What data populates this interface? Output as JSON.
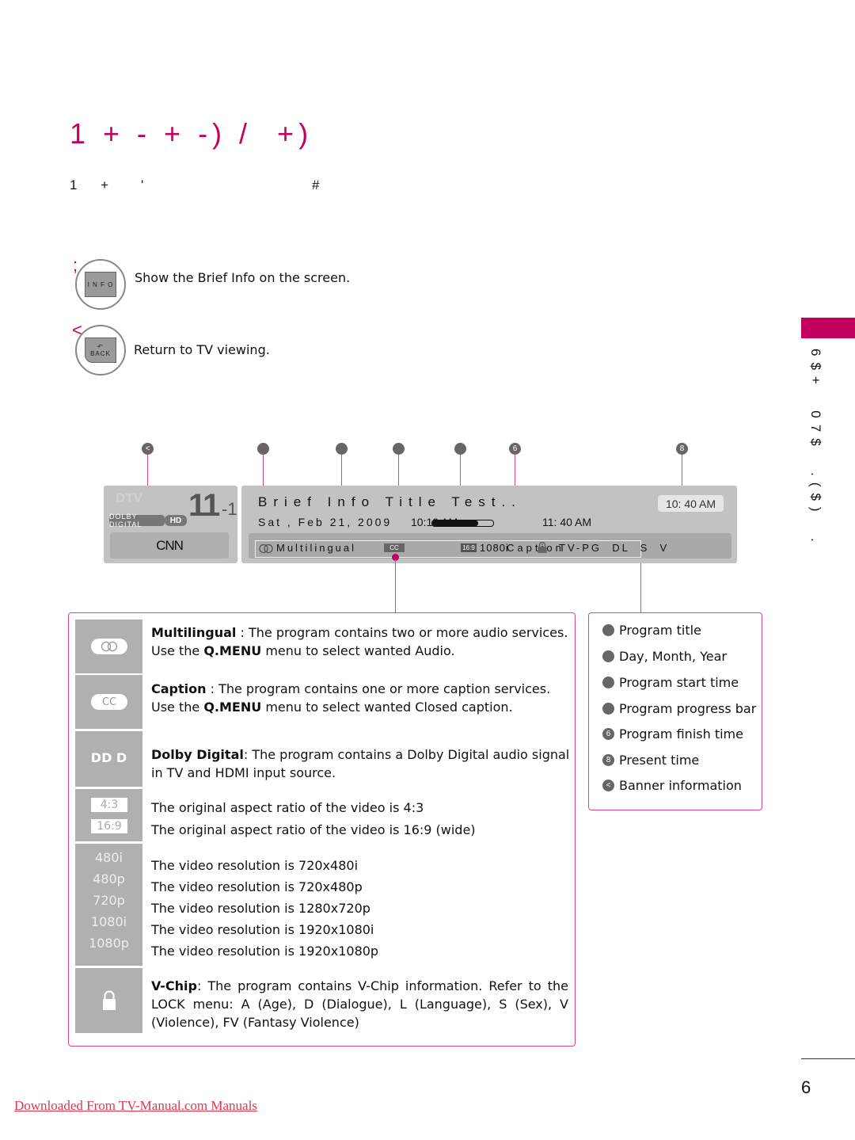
{
  "header": {
    "title": "1 + - + -) /  +)",
    "subtitle": "1     +       '                                     #"
  },
  "side_tab": {
    "accent_color": "#c4005f",
    "text": "6$+  07$  .($)  ."
  },
  "buttons": [
    {
      "step_mark": ";",
      "key_label": "I N F O",
      "description": "Show the Brief Info on the screen."
    },
    {
      "step_mark": "<",
      "key_label": "BACK",
      "description": "Return to TV viewing."
    }
  ],
  "markers": [
    {
      "label": "<",
      "meaning": "Banner information"
    },
    {
      "label": "",
      "meaning": "Program title"
    },
    {
      "label": "",
      "meaning": "Day, Month, Year"
    },
    {
      "label": "",
      "meaning": "Program start time"
    },
    {
      "label": "",
      "meaning": "Program progress bar"
    },
    {
      "label": "6",
      "meaning": "Program finish time"
    },
    {
      "label": "8",
      "meaning": "Present time"
    }
  ],
  "banner": {
    "source": "DTV",
    "channel_major": "11",
    "channel_minor": "-1",
    "dolby_badge": "DOLBY DIGITAL",
    "hd_badge": "HD",
    "station": "CNN",
    "program_title": "Brief Info Title Test..",
    "date": "Sat , Feb 21, 2009",
    "start_time": "10:10 AM",
    "finish_time": "11: 40 AM",
    "present_time": "10: 40 AM",
    "progress": 0.75,
    "info_strip": {
      "multilingual": "Multilingual",
      "cc": "CC",
      "ratio": "16:9",
      "resolution": "1080i",
      "caption": "Caption",
      "rating": "TV-PG  DL  S  V"
    }
  },
  "legend": {
    "multilingual": {
      "icon_text": "OO",
      "term": "Multilingual",
      "text": " : The program contains two or more audio services. Use the ",
      "menu": "Q.MENU",
      "text2": " menu to select wanted Audio."
    },
    "caption": {
      "icon_text": "CC",
      "term": "Caption",
      "text": " : The program contains one or more caption services. Use the ",
      "menu": "Q.MENU",
      "text2": " menu to select wanted Closed caption."
    },
    "dolby": {
      "icon_text": "DD D",
      "term": "Dolby Digital",
      "text": ": The program contains a Dolby Digital audio signal in TV and HDMI input source."
    },
    "aspect": [
      {
        "label": "4:3",
        "text": "The original aspect ratio of the video is 4:3"
      },
      {
        "label": "16:9",
        "text": "The original aspect ratio of the video is 16:9 (wide)"
      }
    ],
    "resolutions": [
      {
        "label": "480i",
        "text": "The video resolution is 720x480i"
      },
      {
        "label": "480p",
        "text": "The video resolution is 720x480p"
      },
      {
        "label": "720p",
        "text": "The video resolution is 1280x720p"
      },
      {
        "label": "1080i",
        "text": "The video resolution is 1920x1080i"
      },
      {
        "label": "1080p",
        "text": "The video resolution is 1920x1080p"
      }
    ],
    "vchip": {
      "term": "V-Chip",
      "text": ": The program contains V-Chip information. Refer to the LOCK menu: A (Age), D (Dialogue), L (Language), S (Sex), V (Violence), FV (Fantasy Violence)"
    }
  },
  "key": [
    {
      "badge": "",
      "label": "Program title"
    },
    {
      "badge": "",
      "label": "Day, Month, Year"
    },
    {
      "badge": "",
      "label": "Program start time"
    },
    {
      "badge": "",
      "label": "Program progress bar"
    },
    {
      "badge": "6",
      "label": "Program finish time"
    },
    {
      "badge": "8",
      "label": "Present time"
    },
    {
      "badge": "<",
      "label": "Banner information"
    }
  ],
  "footer": {
    "page_number": "6",
    "link_text": "Downloaded From TV-Manual.com Manuals"
  }
}
